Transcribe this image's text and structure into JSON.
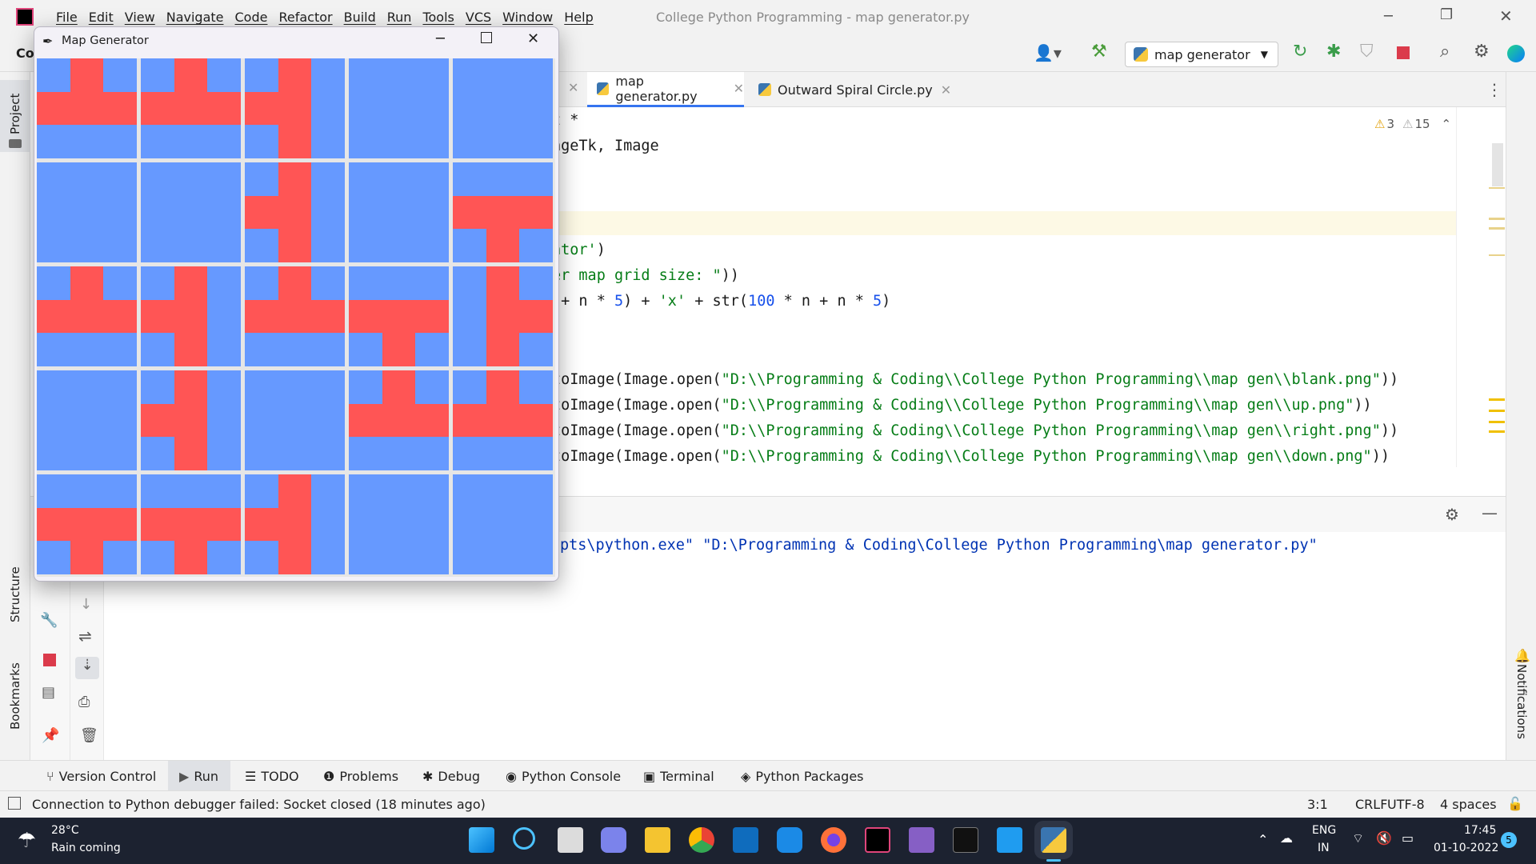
{
  "menubar": {
    "items": [
      "File",
      "Edit",
      "View",
      "Navigate",
      "Code",
      "Refactor",
      "Build",
      "Run",
      "Tools",
      "VCS",
      "Window",
      "Help"
    ],
    "title": "College Python Programming - map generator.py"
  },
  "toolbar": {
    "project_abbrev": "Col",
    "run_config": "map generator"
  },
  "editor_tabs": [
    {
      "label": "map generator.py",
      "active": true
    },
    {
      "label": "Outward Spiral Circle.py",
      "active": false
    }
  ],
  "inspections": {
    "warnings": "3",
    "weak_warnings": "15"
  },
  "code_lines": [
    {
      "text": "t *"
    },
    {
      "text": "ageTk, Image"
    },
    {
      "text": ""
    },
    {
      "text": ""
    },
    {
      "pre": "",
      "str": "ator'",
      "post": ")"
    },
    {
      "pre": "",
      "str": "er map grid size: \"",
      "post": "))"
    },
    {
      "pre": " + n * ",
      "num1": "5",
      "mid": ") + ",
      "str": "'x'",
      "mid2": " + str(",
      "num2": "100",
      "mid3": " * n + n * ",
      "num3": "5",
      "post": ")"
    },
    {
      "text": ""
    },
    {
      "text": ""
    },
    {
      "pre": "toImage(Image.open(",
      "str": "\"D:\\\\Programming & Coding\\\\College Python Programming\\\\map gen\\\\blank.png\"",
      "post": "))"
    },
    {
      "pre": "toImage(Image.open(",
      "str": "\"D:\\\\Programming & Coding\\\\College Python Programming\\\\map gen\\\\up.png\"",
      "post": "))"
    },
    {
      "pre": "toImage(Image.open(",
      "str": "\"D:\\\\Programming & Coding\\\\College Python Programming\\\\map gen\\\\right.png\"",
      "post": "))"
    },
    {
      "pre": "toImage(Image.open(",
      "str": "\"D:\\\\Programming & Coding\\\\College Python Programming\\\\map gen\\\\down.png\"",
      "post": "))"
    }
  ],
  "run_output": "pts\\python.exe\" \"D:\\Programming & Coding\\College Python Programming\\map generator.py\"",
  "left_strip": {
    "project": "Project",
    "structure": "Structure",
    "bookmarks": "Bookmarks"
  },
  "right_strip": {
    "notifications": "Notifications"
  },
  "bottom_tabs": [
    "Version Control",
    "Run",
    "TODO",
    "Problems",
    "Debug",
    "Python Console",
    "Terminal",
    "Python Packages"
  ],
  "status": {
    "message": "Connection to Python debugger failed: Socket closed (18 minutes ago)",
    "position": "3:1",
    "line_sep": "CRLF",
    "encoding": "UTF-8",
    "indent": "4 spaces"
  },
  "map_window": {
    "title": "Map Generator",
    "grid": [
      [
        "up",
        "up",
        "left",
        "blank",
        "blank"
      ],
      [
        "blank",
        "blank",
        "left",
        "blank",
        "down"
      ],
      [
        "up",
        "left",
        "up",
        "down",
        "right"
      ],
      [
        "blank",
        "left",
        "blank",
        "up",
        "up"
      ],
      [
        "down",
        "down",
        "left",
        "blank",
        "blank"
      ]
    ],
    "colors": {
      "background": "#6699ff",
      "road": "#ff5555"
    }
  },
  "taskbar": {
    "temp": "28°C",
    "weather": "Rain coming",
    "lang1": "ENG",
    "lang2": "IN",
    "time": "17:45",
    "date": "01-10-2022",
    "notif_count": "5"
  }
}
